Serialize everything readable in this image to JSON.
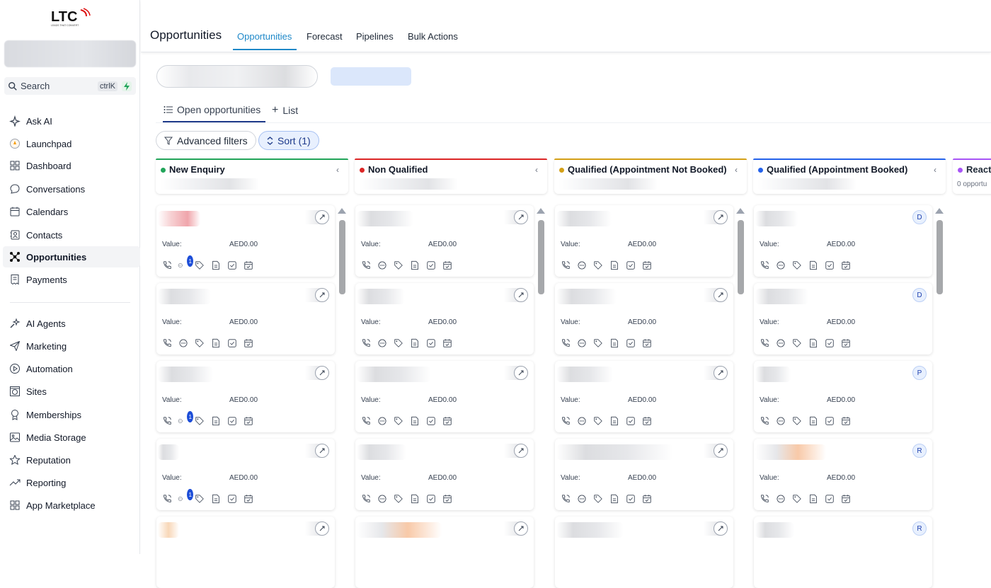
{
  "brand": {
    "logo_text": "LTC",
    "tagline": "LEADS THAT CONVERT"
  },
  "sidebar": {
    "search_label": "Search",
    "search_shortcut": "ctrlK",
    "items": [
      {
        "label": "Ask AI",
        "icon": "sparkle-icon"
      },
      {
        "label": "Launchpad",
        "icon": "rocket-icon"
      },
      {
        "label": "Dashboard",
        "icon": "grid-icon"
      },
      {
        "label": "Conversations",
        "icon": "chat-icon"
      },
      {
        "label": "Calendars",
        "icon": "calendar-icon"
      },
      {
        "label": "Contacts",
        "icon": "contact-card-icon"
      },
      {
        "label": "Opportunities",
        "icon": "network-icon",
        "active": true
      },
      {
        "label": "Payments",
        "icon": "receipt-icon"
      },
      {
        "label": "AI Agents",
        "icon": "sparkle-agent-icon"
      },
      {
        "label": "Marketing",
        "icon": "send-icon"
      },
      {
        "label": "Automation",
        "icon": "play-circle-icon"
      },
      {
        "label": "Sites",
        "icon": "globe-box-icon"
      },
      {
        "label": "Memberships",
        "icon": "badge-icon"
      },
      {
        "label": "Media Storage",
        "icon": "image-icon"
      },
      {
        "label": "Reputation",
        "icon": "star-icon"
      },
      {
        "label": "Reporting",
        "icon": "trend-icon"
      },
      {
        "label": "App Marketplace",
        "icon": "apps-icon"
      }
    ]
  },
  "header": {
    "title": "Opportunities",
    "tabs": [
      "Opportunities",
      "Forecast",
      "Pipelines",
      "Bulk Actions"
    ]
  },
  "views": {
    "open_label": "Open opportunities",
    "list_label": "List"
  },
  "filters": {
    "advanced_label": "Advanced filters",
    "sort_label": "Sort (1)"
  },
  "columns": [
    {
      "name": "New Enquiry",
      "color": "#22a55a"
    },
    {
      "name": "Non Qualified",
      "color": "#dc2626"
    },
    {
      "name": "Qualified (Appointment Not Booked)",
      "color": "#d4a017"
    },
    {
      "name": "Qualified (Appointment Booked)",
      "color": "#2563eb"
    }
  ],
  "col5": {
    "name": "React",
    "sub": "0 opportu",
    "color": "#a855f7"
  },
  "card": {
    "value_label": "Value:",
    "value_amount": "AED0.00"
  },
  "avatars": {
    "col4": [
      "D",
      "D",
      "P",
      "R",
      "R"
    ]
  },
  "badges": {
    "message_count": "1"
  }
}
